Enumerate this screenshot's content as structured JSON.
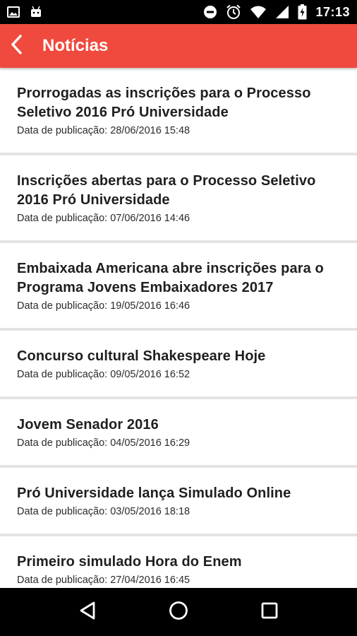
{
  "status_bar": {
    "time": "17:13",
    "icons": [
      "image-icon",
      "android-icon",
      "do-not-disturb-icon",
      "alarm-icon",
      "wifi-icon",
      "signal-icon",
      "battery-charging-icon"
    ]
  },
  "app_bar": {
    "title": "Notícias",
    "back_icon": "chevron-left-icon",
    "color": "#ef4a3d"
  },
  "news": [
    {
      "title": "Prorrogadas as inscrições para o Processo Seletivo 2016 Pró Universidade",
      "date": "Data de publicação: 28/06/2016 15:48"
    },
    {
      "title": "Inscrições abertas para o Processo Seletivo 2016 Pró Universidade",
      "date": "Data de publicação: 07/06/2016 14:46"
    },
    {
      "title": "Embaixada Americana abre inscrições para o Programa Jovens Embaixadores 2017",
      "date": "Data de publicação: 19/05/2016 16:46"
    },
    {
      "title": "Concurso cultural Shakespeare Hoje",
      "date": "Data de publicação: 09/05/2016 16:52"
    },
    {
      "title": "Jovem Senador 2016",
      "date": "Data de publicação: 04/05/2016 16:29"
    },
    {
      "title": "Pró Universidade lança Simulado Online",
      "date": "Data de publicação: 03/05/2016 18:18"
    },
    {
      "title": "Primeiro simulado Hora do Enem",
      "date": "Data de publicação: 27/04/2016 16:45"
    }
  ],
  "nav_bar": {
    "icons": [
      "back-triangle-icon",
      "home-circle-icon",
      "recents-square-icon"
    ]
  }
}
